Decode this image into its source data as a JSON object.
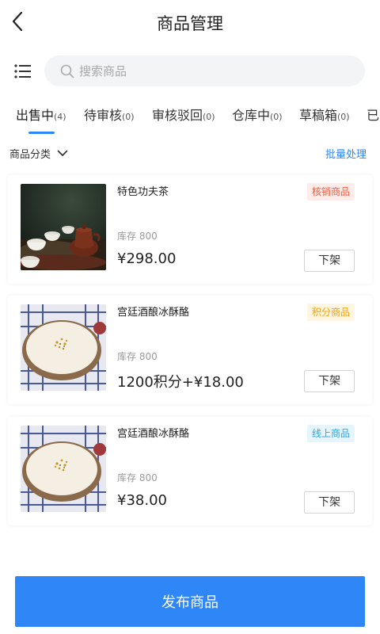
{
  "nav": {
    "title": "商品管理",
    "back_icon": "chevron-left-icon"
  },
  "search": {
    "placeholder": "搜索商品",
    "value": ""
  },
  "tabs": [
    {
      "label": "出售中",
      "count": "(4)",
      "active": true
    },
    {
      "label": "待审核",
      "count": "(0)"
    },
    {
      "label": "审核驳回",
      "count": "(0)"
    },
    {
      "label": "仓库中",
      "count": "(0)"
    },
    {
      "label": "草稿箱",
      "count": "(0)"
    },
    {
      "label": "已",
      "count": ""
    }
  ],
  "filter": {
    "category_label": "商品分类",
    "batch_label": "批量处理"
  },
  "products": [
    {
      "name": "特色功夫茶",
      "tag": "核销商品",
      "tag_color": "#ee5b3f",
      "stock": "库存 800",
      "price": "¥298.00",
      "action": "下架"
    },
    {
      "name": "宫廷酒酿冰酥酪",
      "tag": "积分商品",
      "tag_color": "#f2a20c",
      "stock": "库存 800",
      "price": "1200积分+¥18.00",
      "action": "下架"
    },
    {
      "name": "宫廷酒酿冰酥酪",
      "tag": "线上商品",
      "tag_color": "#2aa7e3",
      "stock": "库存 800",
      "price": "¥38.00",
      "action": "下架"
    }
  ],
  "publish_label": "发布商品",
  "colors": {
    "accent": "#2f86f6"
  }
}
